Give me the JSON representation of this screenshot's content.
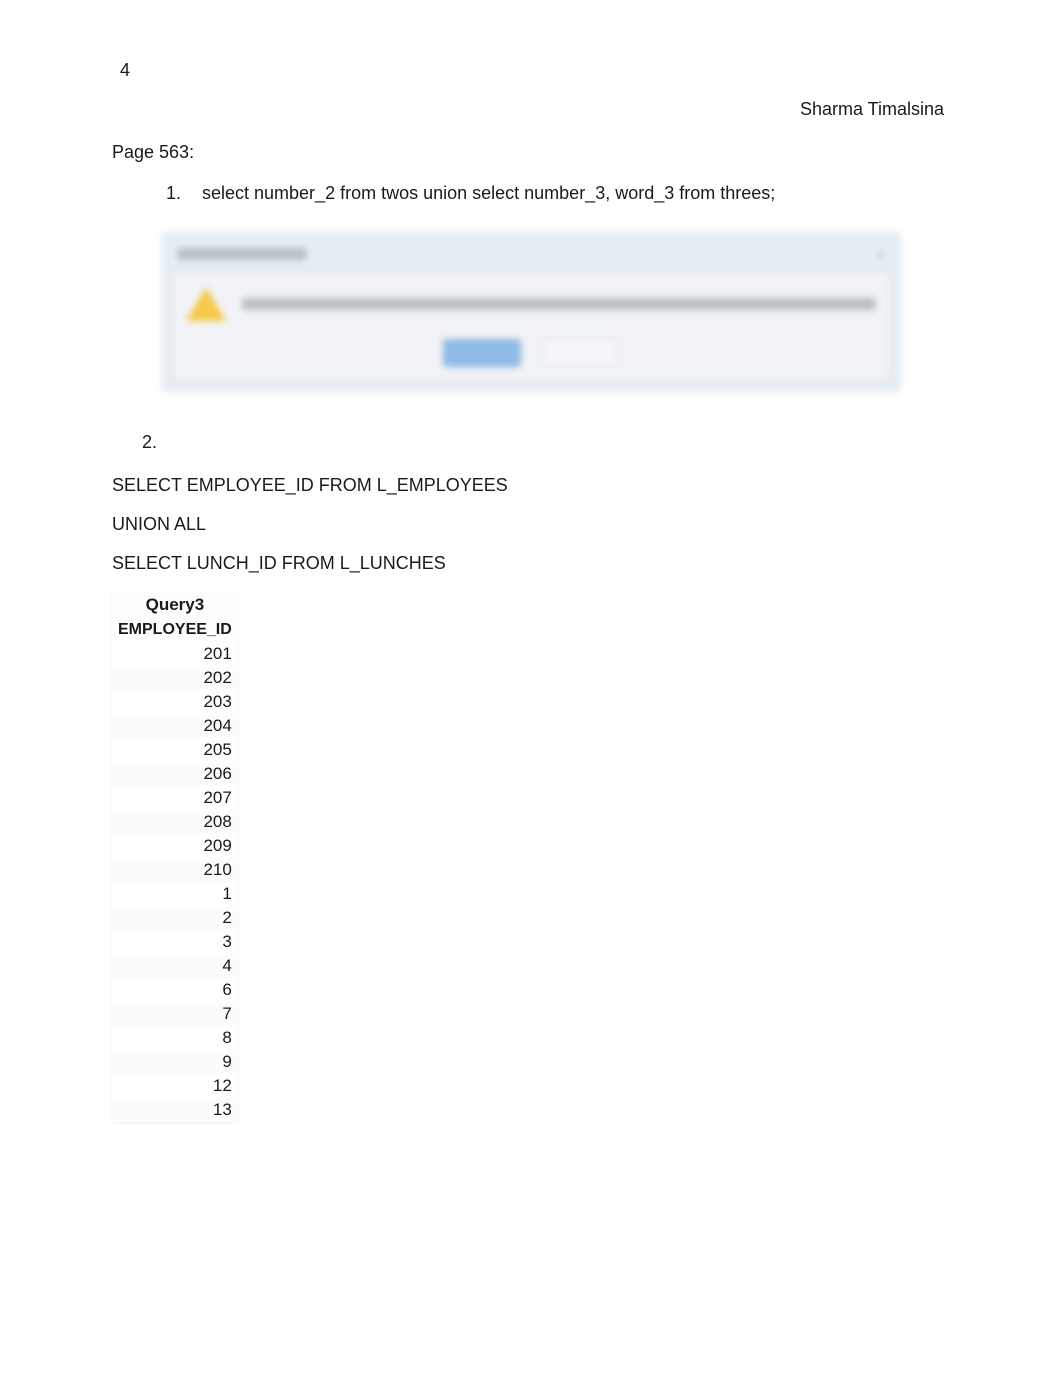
{
  "header": {
    "page_num": "4",
    "author": "Sharma Timalsina"
  },
  "page_label": "Page 563:",
  "item1": {
    "num": "1.",
    "text": "select number_2 from twos union select number_3, word_3 from threes;"
  },
  "item2": {
    "num": "2."
  },
  "sql": {
    "line1": "SELECT EMPLOYEE_ID FROM L_EMPLOYEES",
    "line2": "UNION ALL",
    "line3": "SELECT LUNCH_ID FROM L_LUNCHES"
  },
  "table": {
    "title": "Query3",
    "column": "EMPLOYEE_ID",
    "rows": [
      "201",
      "202",
      "203",
      "204",
      "205",
      "206",
      "207",
      "208",
      "209",
      "210",
      "1",
      "2",
      "3",
      "4",
      "6",
      "7",
      "8",
      "9",
      "12",
      "13"
    ]
  }
}
